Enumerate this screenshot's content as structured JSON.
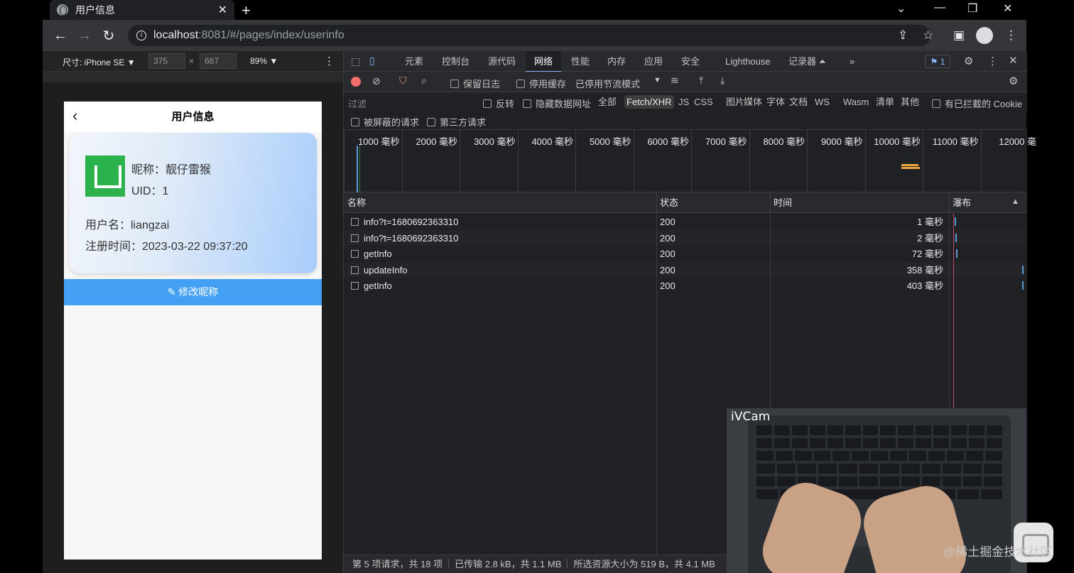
{
  "browser": {
    "tab_title": "用户信息",
    "close_glyph": "✕",
    "new_tab_glyph": "+",
    "url_host": "localhost",
    "url_rest": ":8081/#/pages/index/userinfo"
  },
  "device_toolbar": {
    "device_label": "尺寸: iPhone SE ▼",
    "width": "375",
    "times": "×",
    "height": "667",
    "zoom": "89% ▼"
  },
  "app": {
    "title": "用户信息",
    "back_glyph": "‹",
    "nickname": "昵称：靓仔雷猴",
    "uid": "UID：1",
    "username": "用户名：liangzai",
    "register_time": "注册时间：2023-03-22 09:37:20",
    "edit_button": "✎ 修改昵称"
  },
  "devtools": {
    "tabs": [
      "元素",
      "控制台",
      "源代码",
      "网络",
      "性能",
      "内存",
      "应用",
      "安全",
      "Lighthouse",
      "记录器 ⏶",
      "»"
    ],
    "active_tab": "网络",
    "issues_badge": "⚑ 1",
    "toolbar": {
      "preserve_log": "保留日志",
      "disable_cache": "停用缓存",
      "throttle": "已停用节流模式"
    },
    "filter": {
      "placeholder": "过滤",
      "invert": "反转",
      "hide_data_urls": "隐藏数据网址",
      "types": [
        "全部",
        "Fetch/XHR",
        "JS",
        "CSS",
        "图片",
        "媒体",
        "字体",
        "文档",
        "WS",
        "Wasm",
        "清单",
        "其他"
      ],
      "selected_type": "Fetch/XHR",
      "blocked_cookies": "有已拦截的 Cookie",
      "blocked_requests": "被屏蔽的请求",
      "third_party": "第三方请求"
    },
    "overview_ticks": [
      "1000 毫秒",
      "2000 毫秒",
      "3000 毫秒",
      "4000 毫秒",
      "5000 毫秒",
      "6000 毫秒",
      "7000 毫秒",
      "8000 毫秒",
      "9000 毫秒",
      "10000 毫秒",
      "11000 毫秒",
      "12000 毫"
    ],
    "columns": {
      "name": "名称",
      "status": "状态",
      "time": "时间",
      "waterfall": "瀑布"
    },
    "requests": [
      {
        "name": "info?t=1680692363310",
        "status": "200",
        "time": "1 毫秒"
      },
      {
        "name": "info?t=1680692363310",
        "status": "200",
        "time": "2 毫秒"
      },
      {
        "name": "getInfo",
        "status": "200",
        "time": "72 毫秒"
      },
      {
        "name": "updateInfo",
        "status": "200",
        "time": "358 毫秒"
      },
      {
        "name": "getInfo",
        "status": "200",
        "time": "403 毫秒"
      }
    ],
    "statusbar": {
      "requests": "第 5 项请求，共 18 项",
      "transferred": "已传输 2.8 kB，共 1.1 MB",
      "resources": "所选资源大小为 519 B，共 4.1 MB"
    }
  },
  "overlay": {
    "ivcam_label": "iVCam",
    "watermark": "@稀土掘金技术社区"
  },
  "colors": {
    "accent_blue": "#43a0f5",
    "logo_green": "#2bb24c",
    "devtools_bg": "#202124",
    "record_red": "#f26c6c"
  }
}
